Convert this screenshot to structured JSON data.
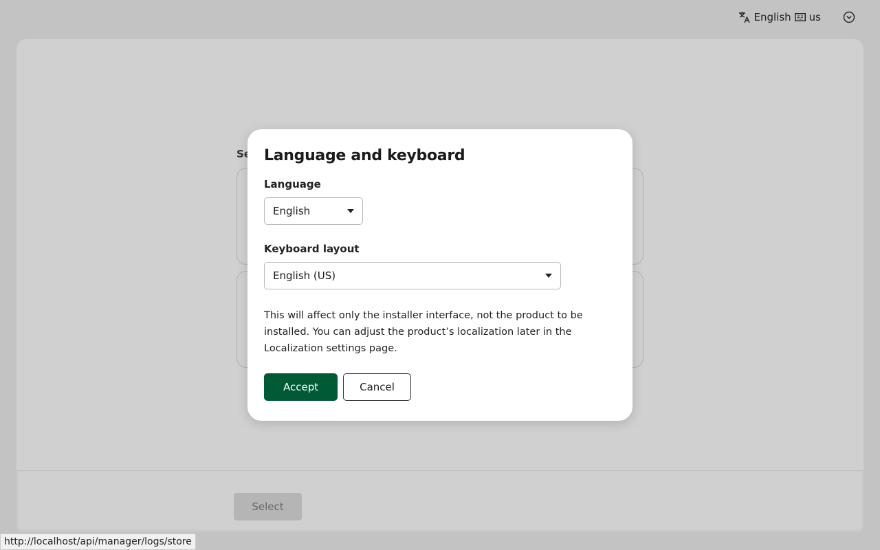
{
  "topbar": {
    "language": "English",
    "keyboard": "us"
  },
  "background": {
    "heading_fragment": "Se",
    "select_label": "Select"
  },
  "status_url": "http://localhost/api/manager/logs/store",
  "modal": {
    "title": "Language and keyboard",
    "language_label": "Language",
    "language_value": "English",
    "keyboard_label": "Keyboard layout",
    "keyboard_value": "English (US)",
    "description": "This will affect only the installer interface, not the product to be installed. You can adjust the product’s localization later in the Localization settings page.",
    "accept_label": "Accept",
    "cancel_label": "Cancel"
  },
  "colors": {
    "accent": "#005a36"
  }
}
